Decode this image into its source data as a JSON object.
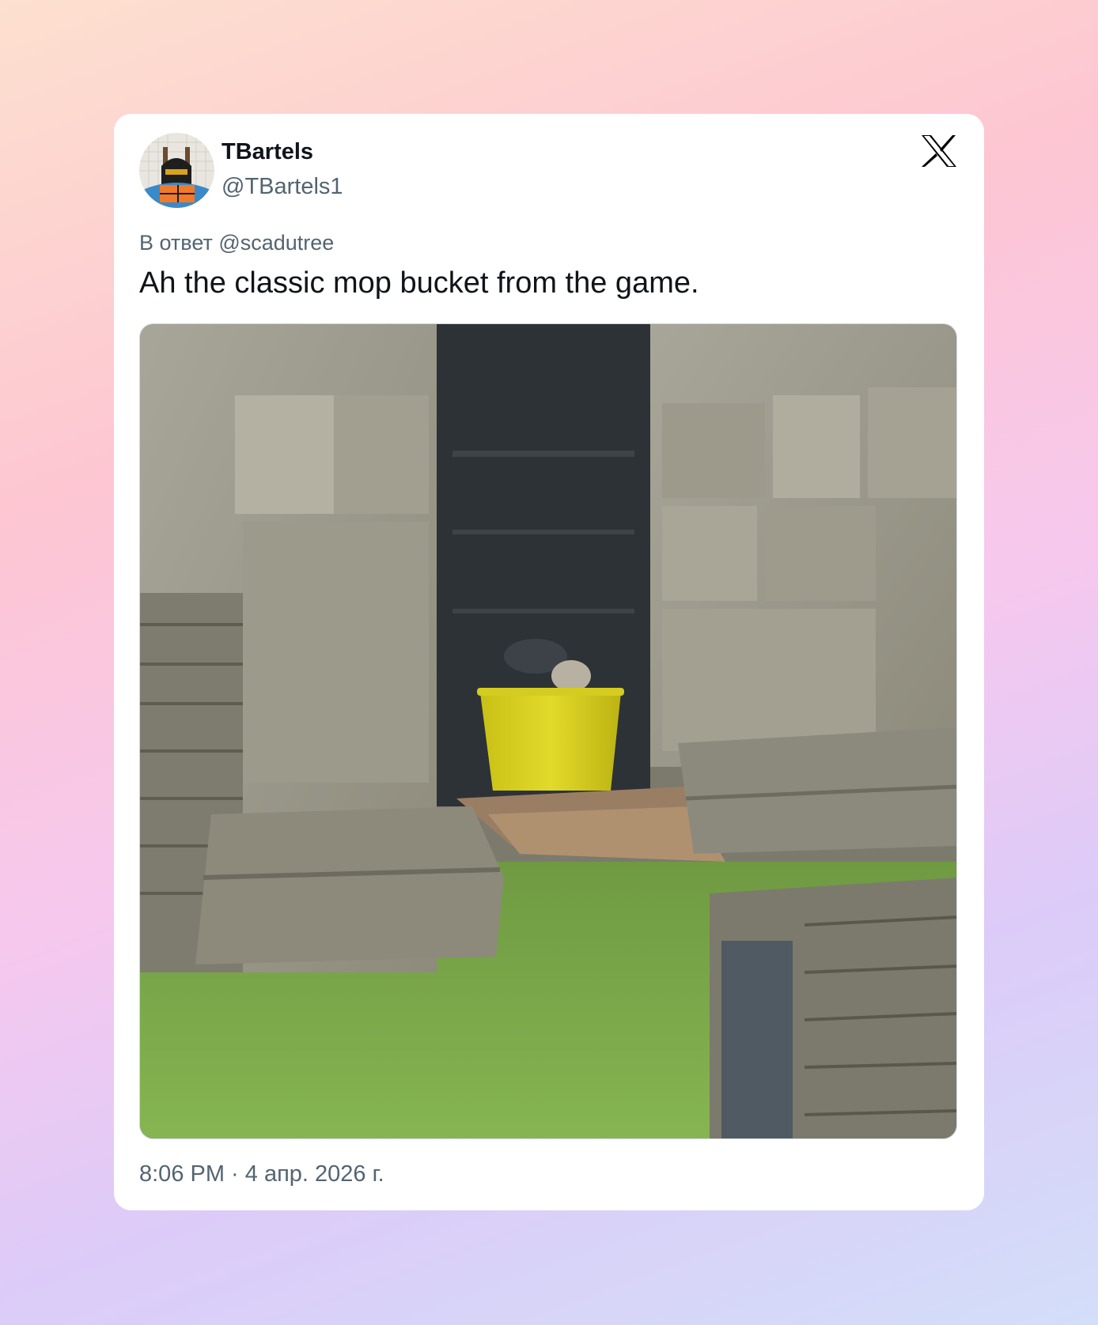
{
  "author": {
    "display_name": "TBartels",
    "handle": "@TBartels1",
    "avatar_icon": "robot-avatar"
  },
  "platform_icon": "x-logo-icon",
  "reply_to": "В ответ @scadutree",
  "text": "Ah the classic mop bucket from the game.",
  "media": {
    "icon": "photo-stone-ruins-yellow-bucket"
  },
  "timestamp": "8:06 PM · 4 апр. 2026 г.",
  "colors": {
    "text_primary": "#0f1419",
    "text_secondary": "#536471",
    "card_bg": "#ffffff",
    "bucket_yellow": "#d8cf1c"
  }
}
